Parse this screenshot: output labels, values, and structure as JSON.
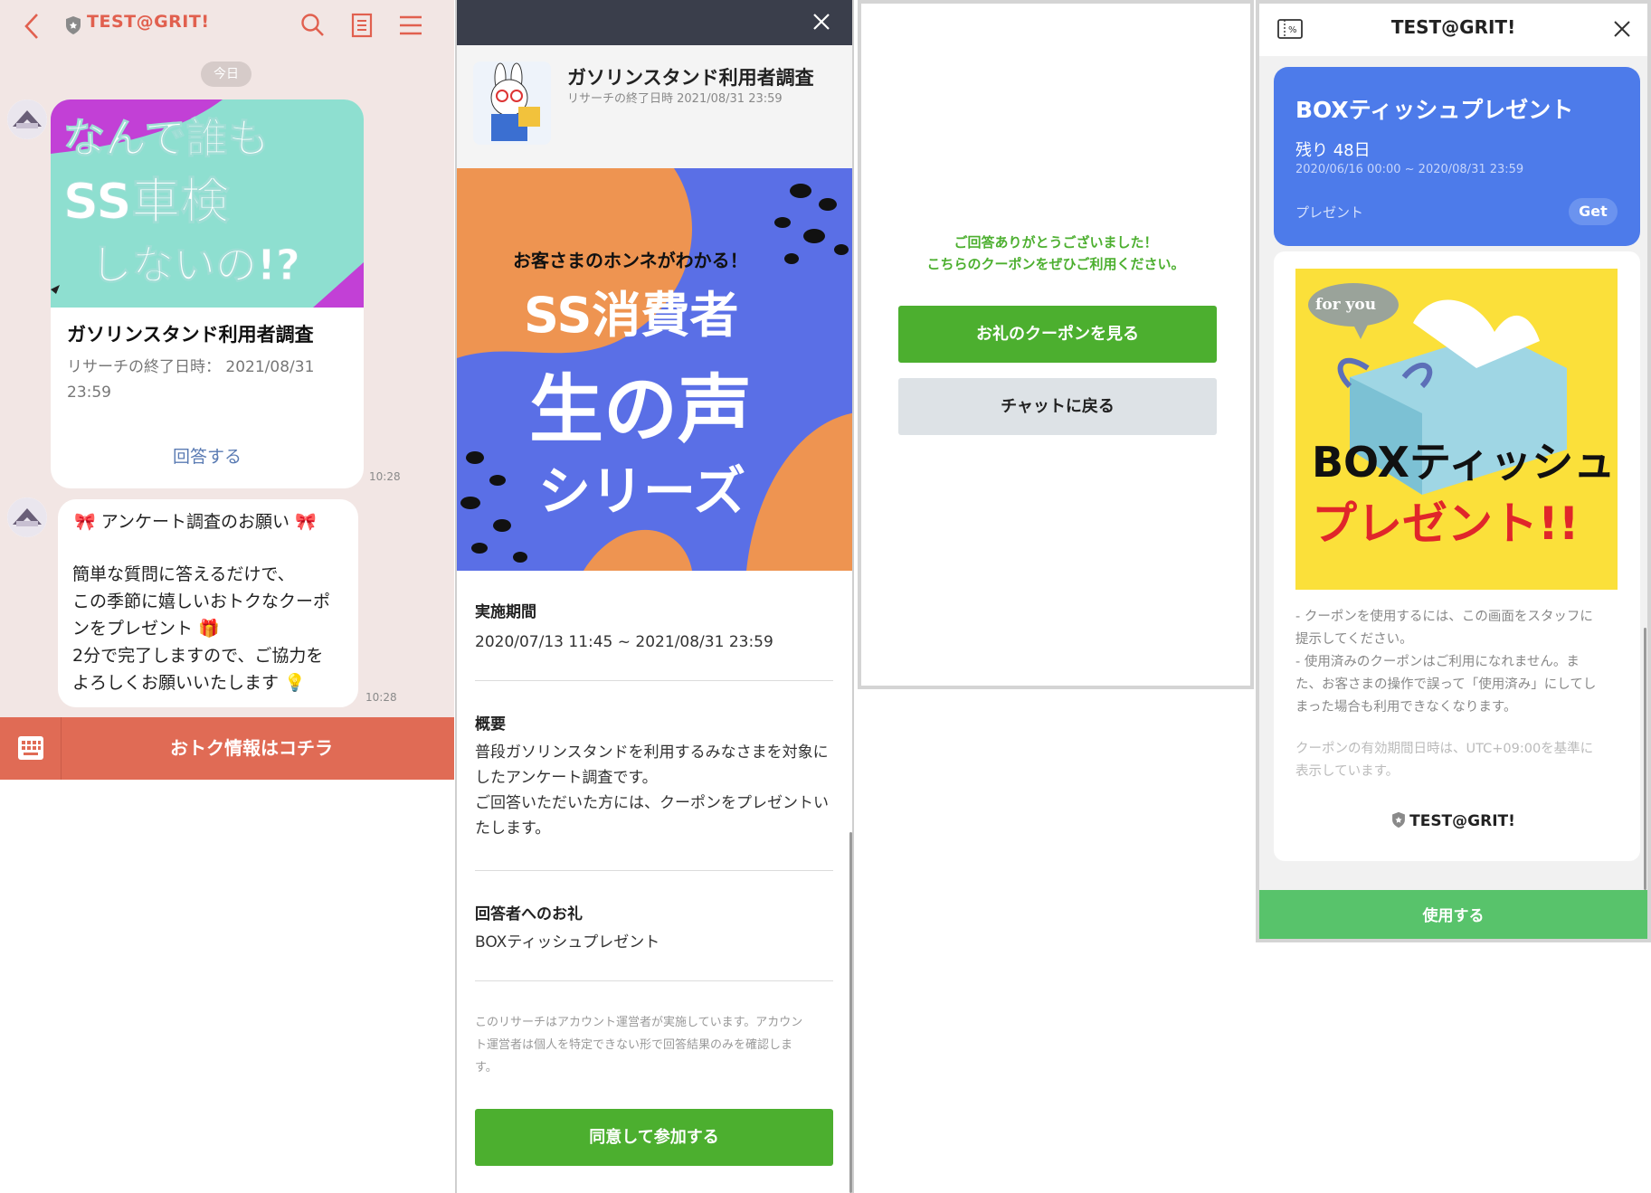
{
  "chat": {
    "title": "TEST@GRIT!",
    "date_pill": "今日",
    "card": {
      "title": "ガソリンスタンド利用者調査",
      "deadline": "リサーチの終了日時： 2021/08/31 23:59",
      "answer_link": "回答する",
      "time": "10:28",
      "image_lines": [
        "なんで誰も",
        "SS車検",
        "しないの!?"
      ]
    },
    "message": {
      "heading": "アンケート調査のお願い",
      "lines": [
        "簡単な質問に答えるだけで、",
        "この季節に嬉しいおトクなクーポ",
        "ンをプレゼント",
        "2分で完了しますので、ご協力を",
        "よろしくお願いいたします"
      ],
      "time": "10:28"
    },
    "bottom_bar_label": "おトク情報はコチラ"
  },
  "survey": {
    "title": "ガソリンスタンド利用者調査",
    "deadline": "リサーチの終了日時 2021/08/31 23:59",
    "banner": {
      "line1": "お客さまのホンネがわかる！",
      "line2": "SS消費者",
      "line3": "生の声",
      "line4": "シリーズ"
    },
    "period_label": "実施期間",
    "period_value": "2020/07/13 11:45 ~ 2021/08/31 23:59",
    "summary_label": "概要",
    "summary_lines": [
      "普段ガソリンスタンドを利用するみなさまを対象に",
      "したアンケート調査です。",
      "ご回答いただいた方には、クーポンをプレゼントい",
      "たします。"
    ],
    "reward_label": "回答者へのお礼",
    "reward_value": "BOXティッシュプレゼント",
    "note_lines": [
      "このリサーチはアカウント運営者が実施しています。アカウン",
      "ト運営者は個人を特定できない形で回答結果のみを確認しま",
      "す。"
    ],
    "agree_button": "同意して参加する"
  },
  "thanks": {
    "line1": "ご回答ありがとうございました！",
    "line2": "こちらのクーポンをぜひご利用ください。",
    "coupon_button": "お礼のクーポンを見る",
    "back_button": "チャットに戻る"
  },
  "coupon": {
    "app_title": "TEST@GRIT!",
    "title": "BOXティッシュプレゼント",
    "remaining": "残り 48日",
    "period": "2020/06/16 00:00 ~ 2020/08/31 23:59",
    "type": "プレゼント",
    "get_button": "Get",
    "image": {
      "bubble": "for you",
      "line1": "BOXティッシュ",
      "line2": "プレゼント!!"
    },
    "terms_lines": [
      "- クーポンを使用するには、この画面をスタッフに",
      "提示してください。",
      "- 使用済みのクーポンはご利用になれません。ま",
      "た、お客さまの操作で誤って「使用済み」にしてし",
      "まった場合も利用できなくなります。"
    ],
    "tz_lines": [
      "クーポンの有効期間日時は、UTC+09:00を基準に",
      "表示しています。"
    ],
    "account": "TEST@GRIT!",
    "use_button": "使用する"
  },
  "colors": {
    "chat_accent": "#e1604f",
    "green": "#4caf2f",
    "coupon_blue": "#4d7bea",
    "use_green": "#58c36b"
  }
}
